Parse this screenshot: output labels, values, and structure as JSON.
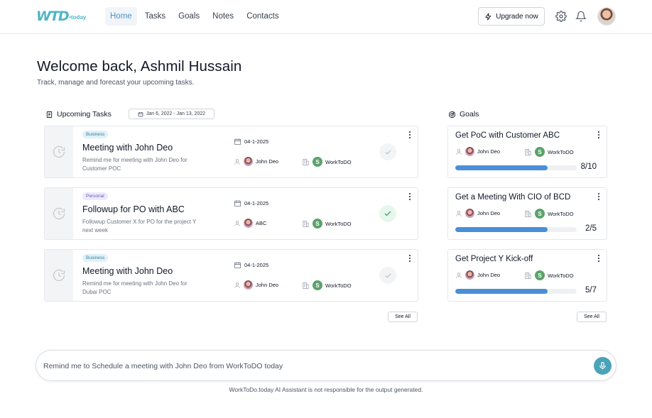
{
  "brand": {
    "logo_main": "WTD",
    "logo_sub": "•today",
    "accent": "#4fb6c6"
  },
  "nav": [
    {
      "label": "Home",
      "active": true
    },
    {
      "label": "Tasks"
    },
    {
      "label": "Goals"
    },
    {
      "label": "Notes"
    },
    {
      "label": "Contacts"
    }
  ],
  "header": {
    "upgrade_label": "Upgrade now",
    "icons": [
      "lightning-icon",
      "gear-icon",
      "bell-icon",
      "avatar"
    ]
  },
  "welcome": {
    "title": "Welcome back, Ashmil Hussain",
    "subtitle": "Track, manage and forecast your upcoming tasks."
  },
  "tasks_section": {
    "title": "Upcoming Tasks",
    "date_range": "Jan 6, 2022 - Jan 13, 2022",
    "see_all": "See All",
    "items": [
      {
        "tag": "Business",
        "title": "Meeting with  John Deo",
        "desc": "Remind me for meeting with John Deo for Customer POC",
        "date": "04-1-2025",
        "person": "John Deo",
        "org_initial": "S",
        "org": "WorkToDO",
        "done": false
      },
      {
        "tag": "Personal",
        "title": "Followup for PO with  ABC",
        "desc": "Followup Customer X for PO for the project Y next week",
        "date": "04-1-2025",
        "person": "ABC",
        "org_initial": "S",
        "org": "WorkToDO",
        "done": true
      },
      {
        "tag": "Business",
        "title": "Meeting with  John Deo",
        "desc": "Remind me for meeting with John Deo for Dubai POC",
        "date": "04-1-2025",
        "person": "John Deo",
        "org_initial": "S",
        "org": "WorkToDO",
        "done": false
      }
    ]
  },
  "goals_section": {
    "title": "Goals",
    "see_all": "See All",
    "items": [
      {
        "title": "Get PoC with Customer ABC",
        "person": "John Deo",
        "org_initial": "S",
        "org": "WorkToDO",
        "progress_text": "8/10",
        "progress": 0.76
      },
      {
        "title": "Get a Meeting With CIO of BCD",
        "person": "John Deo",
        "org_initial": "S",
        "org": "WorkToDO",
        "progress_text": "2/5",
        "progress": 0.76
      },
      {
        "title": "Get Project Y Kick-off",
        "person": "John Deo",
        "org_initial": "S",
        "org": "WorkToDO",
        "progress_text": "5/7",
        "progress": 0.76
      }
    ]
  },
  "assistant": {
    "input_value": "Remind me to Schedule a meeting with John Deo from WorkToDO today",
    "disclaimer": "WorkToDo.today AI Assistant is not responsible for the output generated."
  },
  "colors": {
    "progress": "#4a8fd6",
    "mic": "#4aa3b8",
    "check_done": "#3aa35f"
  }
}
